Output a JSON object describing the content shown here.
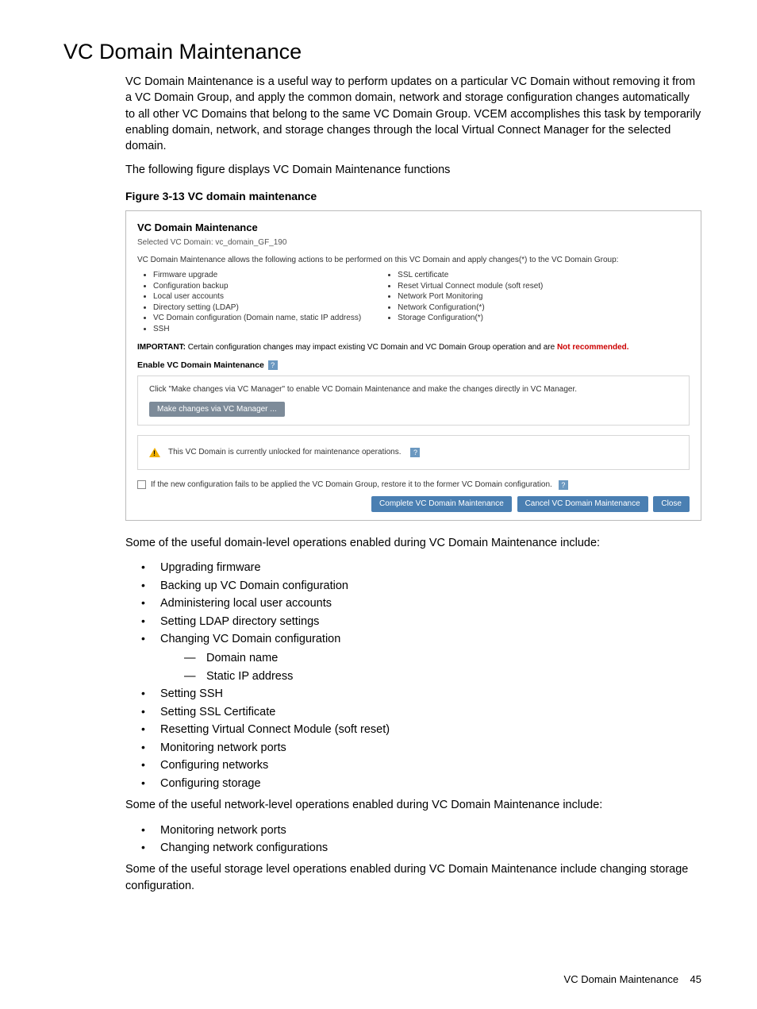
{
  "title": "VC Domain Maintenance",
  "para1": "VC Domain Maintenance is a useful way to perform updates on a particular VC Domain without removing it from a VC Domain Group, and apply the common domain, network and storage configuration changes automatically to all other VC Domains that belong to the same VC Domain Group. VCEM accomplishes this task by temporarily enabling domain, network, and storage changes through the local Virtual Connect Manager for the selected domain.",
  "para2": "The following figure displays VC Domain Maintenance functions",
  "figure_caption": "Figure 3-13 VC domain maintenance",
  "screenshot": {
    "heading": "VC Domain Maintenance",
    "selected": "Selected VC Domain: vc_domain_GF_190",
    "desc": "VC Domain Maintenance allows the following actions to be performed on this VC Domain and apply changes(*) to the VC Domain Group:",
    "left_items": [
      "Firmware upgrade",
      "Configuration backup",
      "Local user accounts",
      "Directory setting (LDAP)",
      "VC Domain configuration (Domain name, static IP address)",
      "SSH"
    ],
    "right_items": [
      "SSL certificate",
      "Reset Virtual Connect module (soft reset)",
      "Network Port Monitoring",
      "Network Configuration(*)",
      "Storage Configuration(*)"
    ],
    "important_prefix": "IMPORTANT:",
    "important_text": " Certain configuration changes may impact existing VC Domain and VC Domain Group operation and are ",
    "important_not": "Not recommended.",
    "enable_label": "Enable VC Domain Maintenance",
    "help": "?",
    "box1_text": "Click \"Make changes via VC Manager\" to enable VC Domain Maintenance and make the changes directly in VC Manager.",
    "box1_btn": "Make changes via VC Manager ...",
    "box2_text": "This VC Domain is currently unlocked for maintenance operations.",
    "check_text": "If the new configuration fails to be applied the VC Domain Group, restore it to the former VC Domain configuration.",
    "btn_complete": "Complete VC Domain Maintenance",
    "btn_cancel": "Cancel VC Domain Maintenance",
    "btn_close": "Close"
  },
  "para3": "Some of the useful domain-level operations enabled during VC Domain Maintenance include:",
  "domain_ops": [
    "Upgrading firmware",
    "Backing up VC Domain configuration",
    "Administering local user accounts",
    "Setting LDAP directory settings",
    "Changing VC Domain configuration",
    "Setting SSH",
    "Setting SSL Certificate",
    "Resetting Virtual Connect Module (soft reset)",
    "Monitoring network ports",
    "Configuring networks",
    "Configuring storage"
  ],
  "domain_sub": [
    "Domain name",
    "Static IP address"
  ],
  "para4": "Some of the useful network-level operations enabled during VC Domain Maintenance include:",
  "network_ops": [
    "Monitoring network ports",
    "Changing network configurations"
  ],
  "para5": "Some of the useful storage level operations enabled during VC Domain Maintenance include changing storage configuration.",
  "footer_label": "VC Domain Maintenance",
  "footer_page": "45"
}
